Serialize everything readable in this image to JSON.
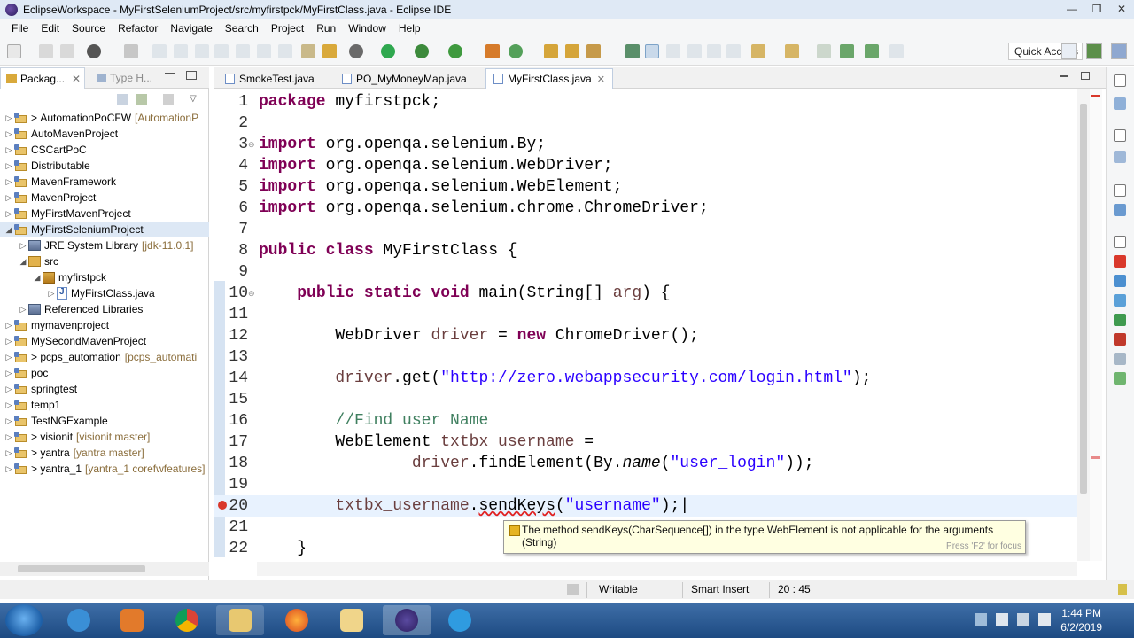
{
  "window": {
    "title": "EclipseWorkspace - MyFirstSeleniumProject/src/myfirstpck/MyFirstClass.java - Eclipse IDE",
    "controls": [
      "—",
      "❐",
      "✕"
    ]
  },
  "menu": [
    "File",
    "Edit",
    "Source",
    "Refactor",
    "Navigate",
    "Search",
    "Project",
    "Run",
    "Window",
    "Help"
  ],
  "toolbar": {
    "quick_access": "Quick Access"
  },
  "left_pane": {
    "tabs": [
      "Packag...",
      "Type H..."
    ],
    "tree": [
      {
        "label": "AutomationPoCFW",
        "suffix": "[AutomationP",
        "prefix": "> ",
        "twisty": "▷",
        "indent": 0,
        "icon": "project"
      },
      {
        "label": "AutoMavenProject",
        "suffix": "",
        "prefix": "",
        "twisty": "▷",
        "indent": 0,
        "icon": "project"
      },
      {
        "label": "CSCartPoC",
        "suffix": "",
        "prefix": "",
        "twisty": "▷",
        "indent": 0,
        "icon": "project"
      },
      {
        "label": "Distributable",
        "suffix": "",
        "prefix": "",
        "twisty": "▷",
        "indent": 0,
        "icon": "project"
      },
      {
        "label": "MavenFramework",
        "suffix": "",
        "prefix": "",
        "twisty": "▷",
        "indent": 0,
        "icon": "project"
      },
      {
        "label": "MavenProject",
        "suffix": "",
        "prefix": "",
        "twisty": "▷",
        "indent": 0,
        "icon": "project"
      },
      {
        "label": "MyFirstMavenProject",
        "suffix": "",
        "prefix": "",
        "twisty": "▷",
        "indent": 0,
        "icon": "project"
      },
      {
        "label": "MyFirstSeleniumProject",
        "suffix": "",
        "prefix": "",
        "twisty": "◢",
        "indent": 0,
        "icon": "project",
        "selected": true
      },
      {
        "label": "JRE System Library",
        "suffix": "[jdk-11.0.1]",
        "prefix": "",
        "twisty": "▷",
        "indent": 1,
        "icon": "library"
      },
      {
        "label": "src",
        "suffix": "",
        "prefix": "",
        "twisty": "◢",
        "indent": 1,
        "icon": "source"
      },
      {
        "label": "myfirstpck",
        "suffix": "",
        "prefix": "",
        "twisty": "◢",
        "indent": 2,
        "icon": "package"
      },
      {
        "label": "MyFirstClass.java",
        "suffix": "",
        "prefix": "",
        "twisty": "▷",
        "indent": 3,
        "icon": "javafile"
      },
      {
        "label": "Referenced Libraries",
        "suffix": "",
        "prefix": "",
        "twisty": "▷",
        "indent": 1,
        "icon": "library"
      },
      {
        "label": "mymavenproject",
        "suffix": "",
        "prefix": "",
        "twisty": "▷",
        "indent": 0,
        "icon": "project"
      },
      {
        "label": "MySecondMavenProject",
        "suffix": "",
        "prefix": "",
        "twisty": "▷",
        "indent": 0,
        "icon": "project"
      },
      {
        "label": "pcps_automation",
        "suffix": "[pcps_automati",
        "prefix": "> ",
        "twisty": "▷",
        "indent": 0,
        "icon": "project"
      },
      {
        "label": "poc",
        "suffix": "",
        "prefix": "",
        "twisty": "▷",
        "indent": 0,
        "icon": "project"
      },
      {
        "label": "springtest",
        "suffix": "",
        "prefix": "",
        "twisty": "▷",
        "indent": 0,
        "icon": "project"
      },
      {
        "label": "temp1",
        "suffix": "",
        "prefix": "",
        "twisty": "▷",
        "indent": 0,
        "icon": "project"
      },
      {
        "label": "TestNGExample",
        "suffix": "",
        "prefix": "",
        "twisty": "▷",
        "indent": 0,
        "icon": "project"
      },
      {
        "label": "visionit",
        "suffix": "[visionit master]",
        "prefix": "> ",
        "twisty": "▷",
        "indent": 0,
        "icon": "project"
      },
      {
        "label": "yantra",
        "suffix": "[yantra master]",
        "prefix": "> ",
        "twisty": "▷",
        "indent": 0,
        "icon": "project"
      },
      {
        "label": "yantra_1",
        "suffix": "[yantra_1 corefwfeatures]",
        "prefix": "> ",
        "twisty": "▷",
        "indent": 0,
        "icon": "project"
      }
    ]
  },
  "editor": {
    "tabs": [
      {
        "label": "SmokeTest.java",
        "active": false
      },
      {
        "label": "PO_MyMoneyMap.java",
        "active": false
      },
      {
        "label": "MyFirstClass.java",
        "active": true
      }
    ],
    "lines": [
      {
        "n": "1",
        "fold": "",
        "html": "<span class=\"kw\">package</span> myfirstpck;"
      },
      {
        "n": "2",
        "fold": "",
        "html": ""
      },
      {
        "n": "3",
        "fold": "⊖",
        "html": "<span class=\"kw\">import</span> org.openqa.selenium.By;"
      },
      {
        "n": "4",
        "fold": "",
        "html": "<span class=\"kw\">import</span> org.openqa.selenium.WebDriver;"
      },
      {
        "n": "5",
        "fold": "",
        "html": "<span class=\"kw\">import</span> org.openqa.selenium.WebElement;"
      },
      {
        "n": "6",
        "fold": "",
        "html": "<span class=\"kw\">import</span> org.openqa.selenium.chrome.ChromeDriver;"
      },
      {
        "n": "7",
        "fold": "",
        "html": ""
      },
      {
        "n": "8",
        "fold": "",
        "html": "<span class=\"kw\">public</span> <span class=\"kw\">class</span> MyFirstClass {"
      },
      {
        "n": "9",
        "fold": "",
        "html": ""
      },
      {
        "n": "10",
        "fold": "⊖",
        "html": "    <span class=\"kw\">public</span> <span class=\"kw\">static</span> <span class=\"kw\">void</span> main(String[] <span class=\"var\">arg</span>) {"
      },
      {
        "n": "11",
        "fold": "",
        "html": ""
      },
      {
        "n": "12",
        "fold": "",
        "html": "        WebDriver <span class=\"var\">driver</span> = <span class=\"kw\">new</span> ChromeDriver();"
      },
      {
        "n": "13",
        "fold": "",
        "html": ""
      },
      {
        "n": "14",
        "fold": "",
        "html": "        <span class=\"var\">driver</span>.get(<span class=\"str\">\"http://zero.webappsecurity.com/login.html\"</span>);"
      },
      {
        "n": "15",
        "fold": "",
        "html": ""
      },
      {
        "n": "16",
        "fold": "",
        "html": "        <span class=\"cmt\">//Find user Name</span>"
      },
      {
        "n": "17",
        "fold": "",
        "html": "        WebElement <span class=\"var\">txtbx_username</span> ="
      },
      {
        "n": "18",
        "fold": "",
        "html": "                <span class=\"var\">driver</span>.findElement(By.<span class=\"it\">name</span>(<span class=\"str\">\"user_login\"</span>));"
      },
      {
        "n": "19",
        "fold": "",
        "html": ""
      },
      {
        "n": "20",
        "fold": "",
        "html": "        <span class=\"var\">txtbx_username</span>.<span class=\"err\">sendKeys</span>(<span class=\"str\">\"username\"</span>);|",
        "current": true,
        "error": true
      },
      {
        "n": "21",
        "fold": "",
        "html": ""
      },
      {
        "n": "22",
        "fold": "",
        "html": "    }"
      }
    ]
  },
  "tooltip": {
    "message": "The method sendKeys(CharSequence[]) in the type WebElement is not applicable for the arguments (String)",
    "hint": "Press 'F2' for focus"
  },
  "statusbar": {
    "writable": "Writable",
    "insert_mode": "Smart Insert",
    "position": "20 : 45"
  },
  "taskbar": {
    "time": "1:44 PM",
    "date": "6/2/2019",
    "apps": [
      "ie",
      "media",
      "chrome",
      "explorer",
      "firefox",
      "folder",
      "eclipse",
      "camera"
    ]
  },
  "colors": {
    "keyword": "#7f0055",
    "string": "#2a00ff",
    "comment": "#3f7f5f",
    "variable": "#6a3e3e",
    "selection": "#dde8f5",
    "taskbar": "#1d4a82"
  }
}
